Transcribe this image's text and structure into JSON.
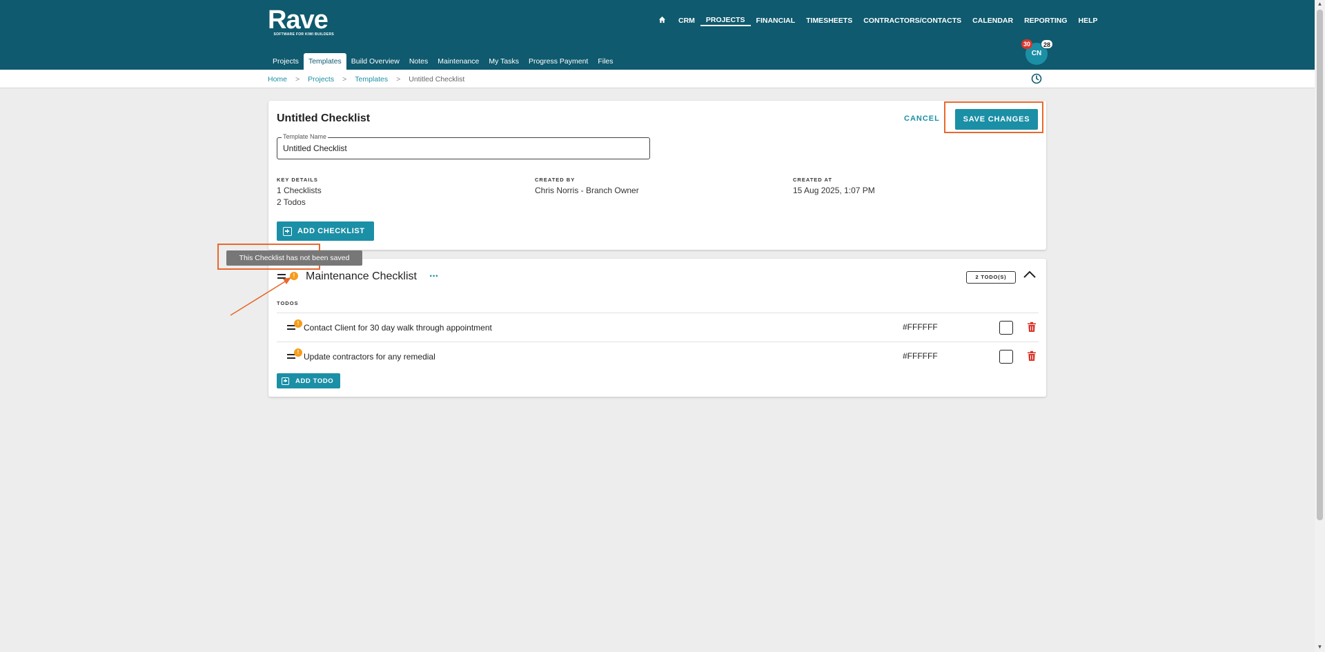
{
  "brand": {
    "name": "Rave",
    "tagline": "SOFTWARE FOR KIWI BUILDERS"
  },
  "main_nav": {
    "home_icon": "home-icon",
    "items": [
      {
        "label": "CRM",
        "active": false
      },
      {
        "label": "PROJECTS",
        "active": true
      },
      {
        "label": "FINANCIAL",
        "active": false
      },
      {
        "label": "TIMESHEETS",
        "active": false
      },
      {
        "label": "CONTRACTORS/CONTACTS",
        "active": false
      },
      {
        "label": "CALENDAR",
        "active": false
      },
      {
        "label": "REPORTING",
        "active": false
      },
      {
        "label": "HELP",
        "active": false
      }
    ]
  },
  "user": {
    "initials": "CN",
    "notifications": "30",
    "messages": "28"
  },
  "sub_nav": {
    "tabs": [
      {
        "label": "Projects",
        "active": false
      },
      {
        "label": "Templates",
        "active": true
      },
      {
        "label": "Build Overview",
        "active": false
      },
      {
        "label": "Notes",
        "active": false
      },
      {
        "label": "Maintenance",
        "active": false
      },
      {
        "label": "My Tasks",
        "active": false
      },
      {
        "label": "Progress Payment",
        "active": false
      },
      {
        "label": "Files",
        "active": false
      }
    ]
  },
  "breadcrumb": {
    "home": "Home",
    "projects": "Projects",
    "templates": "Templates",
    "current": "Untitled Checklist",
    "separator": ">"
  },
  "template_card": {
    "title": "Untitled Checklist",
    "cancel_label": "CANCEL",
    "save_label": "SAVE CHANGES",
    "field_label": "Template Name",
    "field_value": "Untitled Checklist",
    "key_details_head": "KEY DETAILS",
    "key_details_1": "1 Checklists",
    "key_details_2": "2 Todos",
    "created_by_head": "CREATED BY",
    "created_by": "Chris Norris - Branch Owner",
    "created_at_head": "CREATED AT",
    "created_at": "15 Aug 2025, 1:07 PM",
    "add_checklist_label": "ADD CHECKLIST"
  },
  "tooltip": {
    "text": "This Checklist has not been saved"
  },
  "checklist": {
    "title": "Maintenance Checklist",
    "more_label": "···",
    "todo_count": "2 TODO(S)",
    "todos_head": "TODOS",
    "warn_mark": "!",
    "todos": [
      {
        "text": "Contact Client for 30 day walk through appointment",
        "color": "#FFFFFF",
        "checked": false
      },
      {
        "text": "Update contractors for any remedial",
        "color": "#FFFFFF",
        "checked": false
      }
    ],
    "add_todo_label": "ADD TODO"
  },
  "colors": {
    "header": "#0f5a6e",
    "accent": "#1b8fa6",
    "warning": "#f59c1a",
    "annotation": "#e8672c",
    "danger": "#d9352b"
  }
}
